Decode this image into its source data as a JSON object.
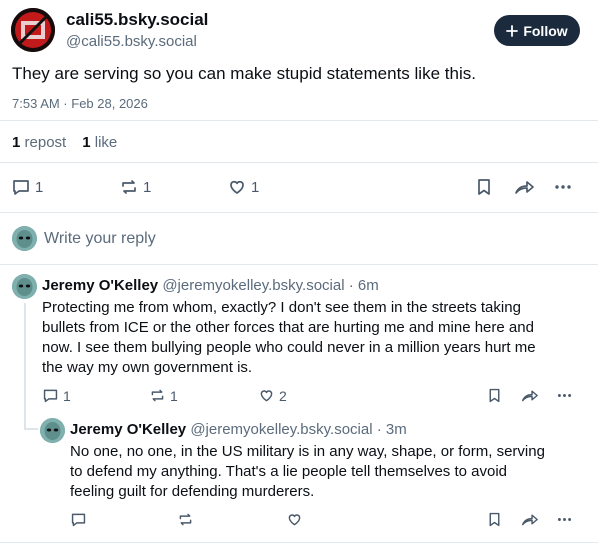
{
  "post": {
    "display_name": "cali55.bsky.social",
    "handle": "@cali55.bsky.social",
    "follow_label": "Follow",
    "text": "They are serving so you can make stupid statements like this.",
    "timestamp": "7:53 AM · Feb 28, 2026",
    "repost_count": "1",
    "repost_label": "repost",
    "like_count": "1",
    "like_label": "like",
    "actions": {
      "reply_count": "1",
      "repost_count": "1",
      "like_count": "1"
    }
  },
  "composer": {
    "placeholder": "Write your reply"
  },
  "replies": [
    {
      "author": "Jeremy O'Kelley",
      "handle": "@jeremyokelley.bsky.social",
      "time": "· 6m",
      "lines": [
        "Protecting me from whom, exactly? I don't see them in the streets taking",
        "bullets from ICE or the other forces that are hurting me and mine here and",
        "now. I see them bullying people who could never in a million years hurt me",
        "the way my own government is."
      ],
      "actions": {
        "reply_count": "1",
        "repost_count": "1",
        "like_count": "2"
      }
    },
    {
      "author": "Jeremy O'Kelley",
      "handle": "@jeremyokelley.bsky.social",
      "time": "· 3m",
      "lines": [
        "No one, no one, in the US military is in any way, shape, or form, serving",
        "to defend my anything. That's a lie people tell themselves to avoid",
        "feeling guilt for defending murderers."
      ],
      "actions": {
        "reply_count": "",
        "repost_count": "",
        "like_count": ""
      }
    }
  ],
  "colors": {
    "follow_bg": "#1b2a3c",
    "text": "#0b0f14",
    "muted": "#5b6b7c",
    "divider": "#e3e8ed"
  }
}
